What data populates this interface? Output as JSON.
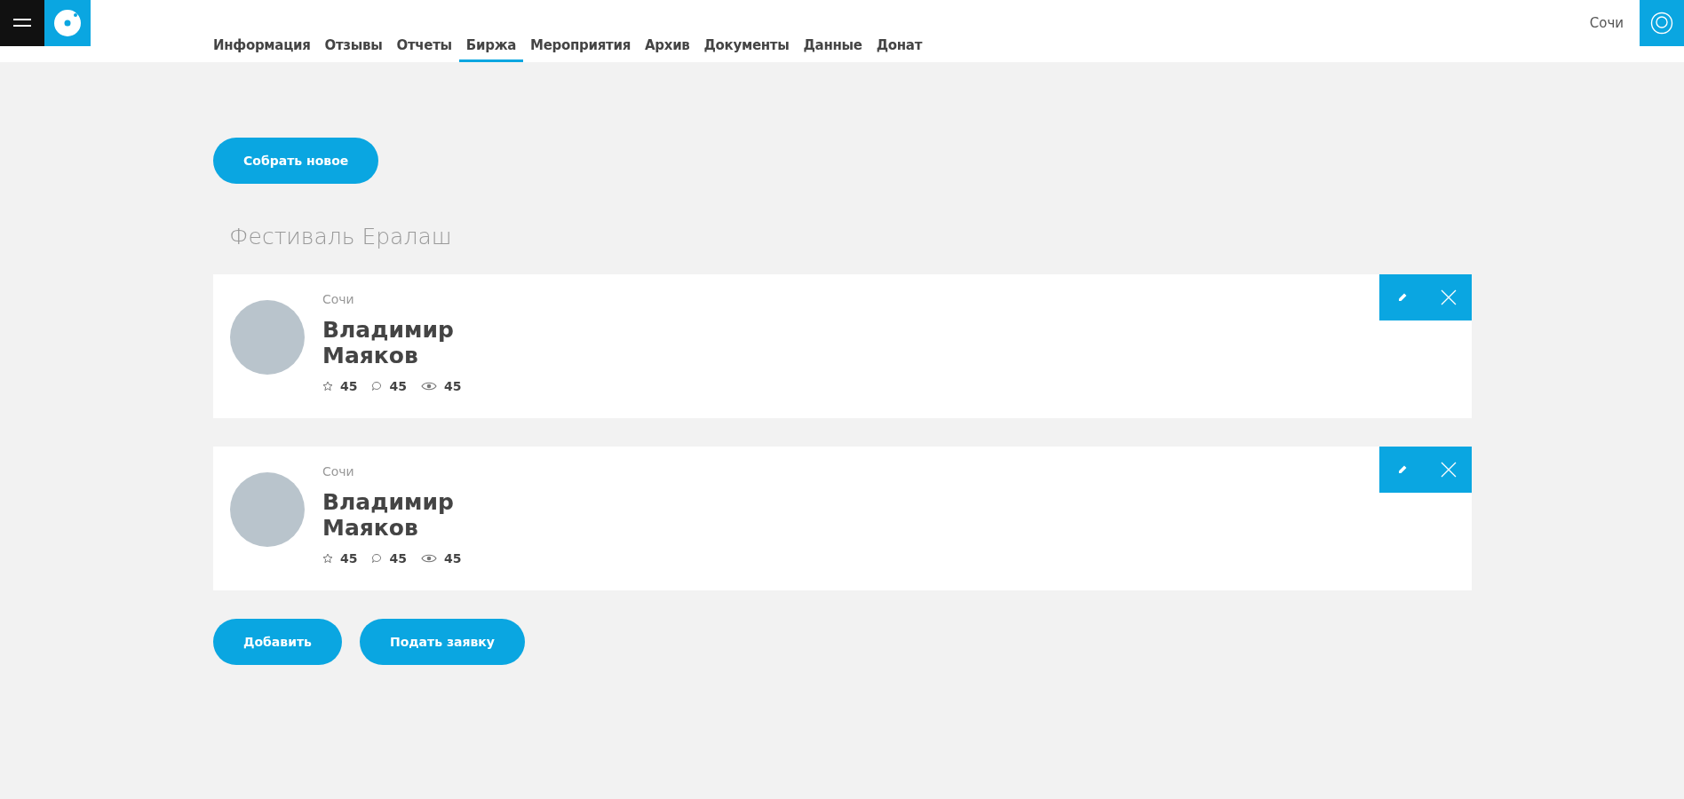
{
  "nav": [
    {
      "label": "Информация",
      "selected": false
    },
    {
      "label": "Отзывы",
      "selected": false
    },
    {
      "label": "Отчеты",
      "selected": false
    },
    {
      "label": "Биржа",
      "selected": true
    },
    {
      "label": "Мероприятия",
      "selected": false
    },
    {
      "label": "Архив",
      "selected": false
    },
    {
      "label": "Документы",
      "selected": false
    },
    {
      "label": "Данные",
      "selected": false
    },
    {
      "label": "Донат",
      "selected": false
    }
  ],
  "city": "Сочи",
  "create_button": "Собрать новое",
  "section_title": "Фестиваль Ералаш",
  "cards": [
    {
      "city": "Сочи",
      "name_first": "Владимир",
      "name_last": "Маяков",
      "stars": "45",
      "comments": "45",
      "views": "45"
    },
    {
      "city": "Сочи",
      "name_first": "Владимир",
      "name_last": "Маяков",
      "stars": "45",
      "comments": "45",
      "views": "45"
    }
  ],
  "buttons": [
    "Добавить",
    "Подать заявку"
  ]
}
